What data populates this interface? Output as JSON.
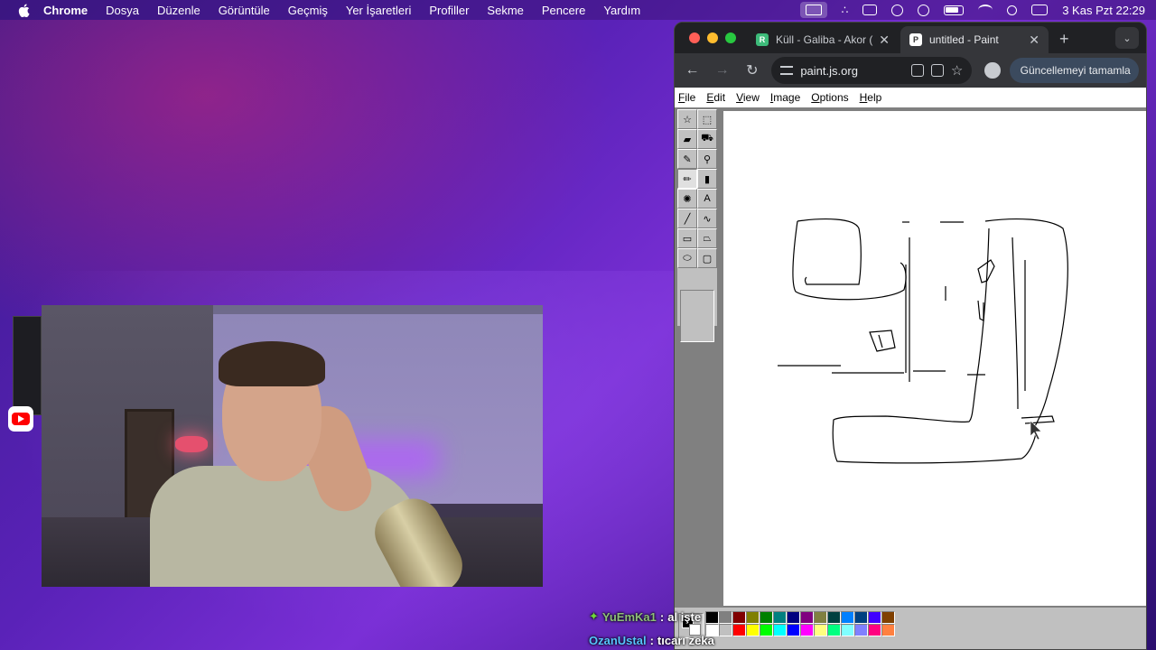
{
  "menubar": {
    "app": "Chrome",
    "items": [
      "Dosya",
      "Düzenle",
      "Görüntüle",
      "Geçmiş",
      "Yer İşaretleri",
      "Profiller",
      "Sekme",
      "Pencere",
      "Yardım"
    ],
    "clock": "3 Kas Pzt  22:29"
  },
  "chrome": {
    "tabs": [
      {
        "title": "Küll - Galiba - Akor (",
        "favicon": "R",
        "active": false
      },
      {
        "title": "untitled - Paint",
        "favicon": "P",
        "active": true
      }
    ],
    "url": "paint.js.org",
    "update_label": "Güncellemeyi tamamla"
  },
  "paint": {
    "menu": [
      "File",
      "Edit",
      "View",
      "Image",
      "Options",
      "Help"
    ],
    "tools": [
      "free-select-icon",
      "rect-select-icon",
      "eraser-icon",
      "fill-bucket-icon",
      "color-picker-icon",
      "magnifier-icon",
      "pencil-icon",
      "brush-icon",
      "airbrush-icon",
      "text-icon",
      "line-icon",
      "curve-icon",
      "rectangle-icon",
      "polygon-icon",
      "ellipse-icon",
      "rounded-rect-icon"
    ],
    "selected_tool": "pencil-icon",
    "palette": [
      "#000000",
      "#808080",
      "#800000",
      "#808000",
      "#008000",
      "#008080",
      "#000080",
      "#800080",
      "#808040",
      "#004040",
      "#0080ff",
      "#004080",
      "#4000ff",
      "#804000",
      "#ffffff",
      "#c0c0c0",
      "#ff0000",
      "#ffff00",
      "#00ff00",
      "#00ffff",
      "#0000ff",
      "#ff00ff",
      "#ffff80",
      "#00ff80",
      "#80ffff",
      "#8080ff",
      "#ff0080",
      "#ff8040"
    ]
  },
  "chat": [
    {
      "user": "YuEmKa1",
      "message": "al işte",
      "badge": "diamond-icon"
    },
    {
      "user": "OzanUstal",
      "message": "tıcarı zeka"
    }
  ],
  "colors": {
    "chrome_bg": "#202124",
    "chrome_toolbar": "#35363a",
    "paint_gray": "#c0c0c0"
  }
}
